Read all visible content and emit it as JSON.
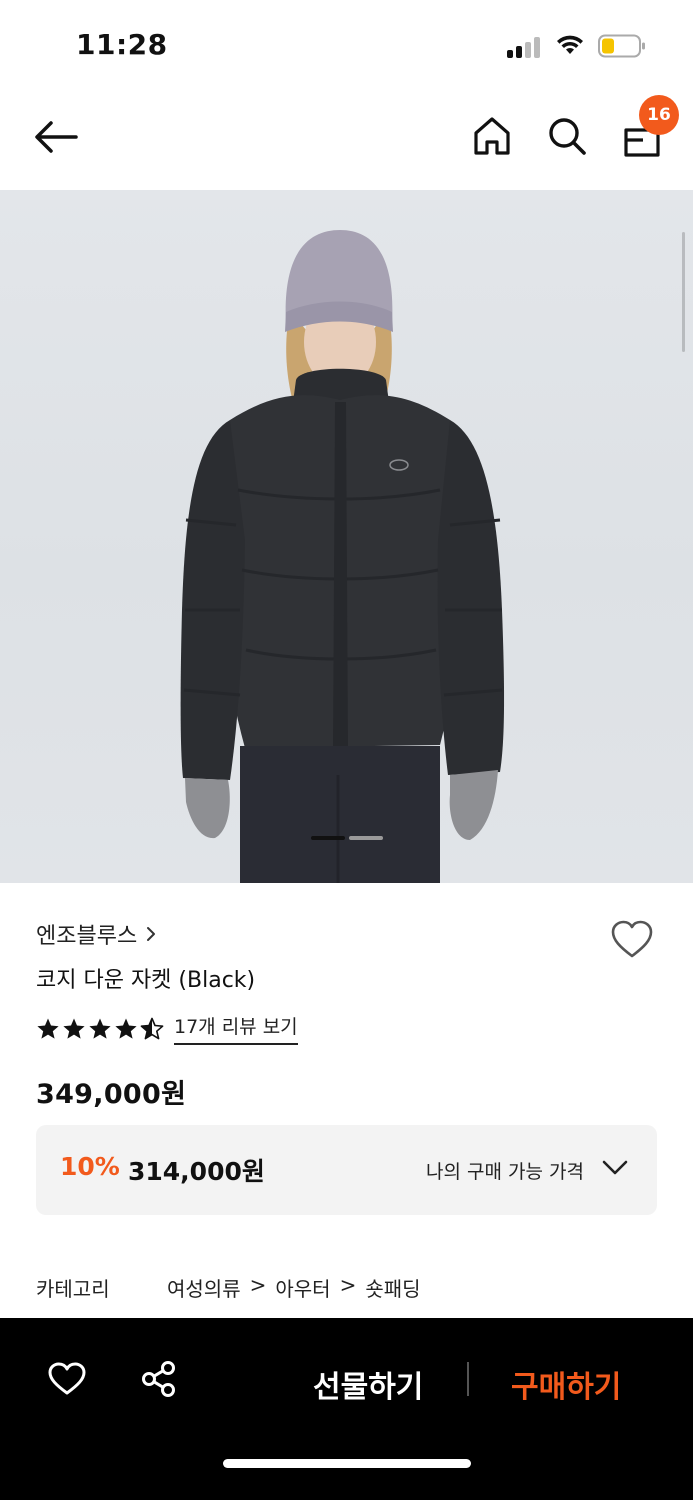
{
  "status_bar": {
    "time": "11:28",
    "battery_color": "#f5c400"
  },
  "nav": {
    "cart_count": "16",
    "icons": [
      "back-arrow-icon",
      "home-icon",
      "search-icon",
      "shopping-bag-icon"
    ]
  },
  "gallery": {
    "image_description_icon": "product-photo",
    "pager_active_index": 0,
    "pager_count": 2
  },
  "product": {
    "brand": "엔조블루스",
    "name": "코지 다운 자켓 (Black)",
    "rating": 4.5,
    "review_link": "17개 리뷰 보기",
    "price": "349,000원",
    "discount_rate": "10%",
    "sale_price": "314,000원",
    "my_price_label": "나의 구매 가능 가격"
  },
  "category": {
    "label": "카테고리",
    "path": [
      "여성의류",
      "아우터",
      "숏패딩"
    ],
    "separator": ">"
  },
  "bottom_bar": {
    "gift_label": "선물하기",
    "buy_label": "구매하기",
    "accent_color": "#f25a1c"
  }
}
